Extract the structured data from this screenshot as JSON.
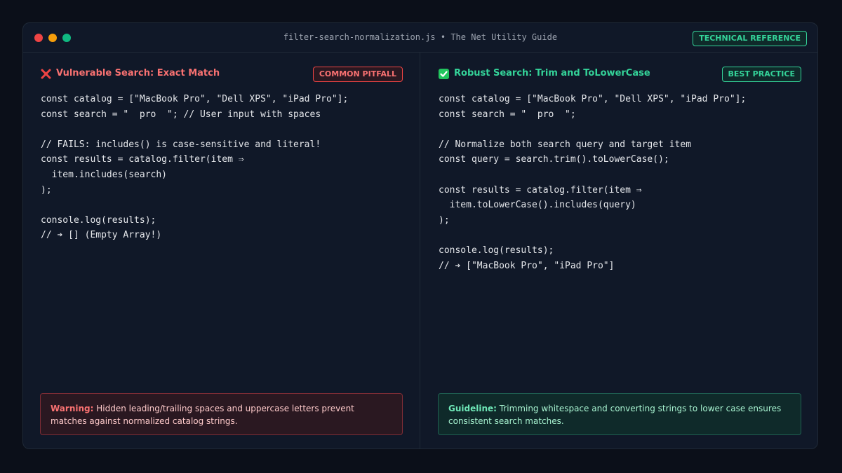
{
  "window": {
    "title": "filter-search-normalization.js • The Net Utility Guide",
    "badge": "TECHNICAL REFERENCE"
  },
  "left_panel": {
    "title": "Vulnerable Search: Exact Match",
    "badge": "COMMON PITFALL",
    "icon": "cross-mark-icon",
    "code_lines": [
      "const catalog = [\"MacBook Pro\", \"Dell XPS\", \"iPad Pro\"];",
      "const search = \"  pro  \"; // User input with spaces",
      "",
      "// FAILS: includes() is case-sensitive and literal!",
      "const results = catalog.filter(item ⇒",
      "  item.includes(search)",
      ");",
      "",
      "console.log(results);",
      "// ➔ [] (Empty Array!)"
    ],
    "note_label": "Warning:",
    "note_text": "Hidden leading/trailing spaces and uppercase letters prevent matches against normalized catalog strings."
  },
  "right_panel": {
    "title": "Robust Search: Trim and ToLowerCase",
    "badge": "BEST PRACTICE",
    "icon": "check-mark-icon",
    "code_lines": [
      "const catalog = [\"MacBook Pro\", \"Dell XPS\", \"iPad Pro\"];",
      "const search = \"  pro  \";",
      "",
      "// Normalize both search query and target item",
      "const query = search.trim().toLowerCase();",
      "",
      "const results = catalog.filter(item ⇒",
      "  item.toLowerCase().includes(query)",
      ");",
      "",
      "console.log(results);",
      "// ➔ [\"MacBook Pro\", \"iPad Pro\"]"
    ],
    "note_label": "Guideline:",
    "note_text": "Trimming whitespace and converting strings to lower case ensures consistent search matches."
  },
  "colors": {
    "dot_red": "#ef4444",
    "dot_yellow": "#f59e0b",
    "dot_green": "#10b981",
    "pitfall": "#f87171",
    "pitfall_border": "#ef4444",
    "pitfall_bg": "#2a1821",
    "pitfall_note_border": "#7f2d36",
    "pitfall_note_text": "#fecaca",
    "success": "#34d399",
    "success_badge_bg": "#0f2a2a",
    "success_note_bg": "#0f2a2a",
    "success_note_border": "#1f5f52",
    "success_note_text": "#a7f3d0",
    "success_label": "#6ee7b7"
  }
}
